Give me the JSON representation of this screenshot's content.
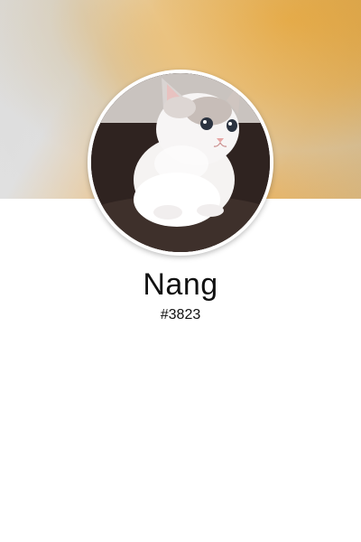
{
  "profile": {
    "name": "Nang",
    "tag": "#3823",
    "avatar_icon": "kitten-photo",
    "banner_colors": [
      "#d9d9d9",
      "#e7b05c",
      "#e2a64a"
    ]
  }
}
